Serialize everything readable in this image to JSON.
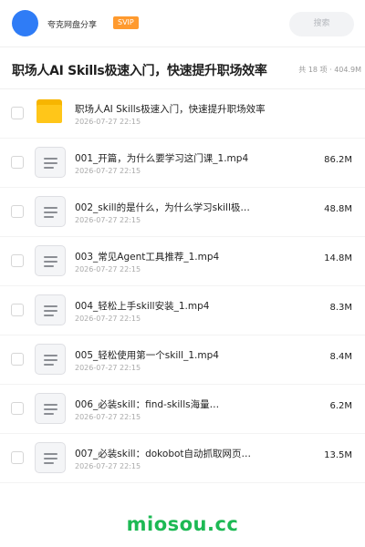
{
  "header": {
    "username": "夸克网盘分享",
    "badge": "SVIP",
    "search_placeholder": "搜索"
  },
  "folder": {
    "title": "职场人AI Skills极速入门，快速提升职场效率",
    "meta": "共 18 项 · 404.9M"
  },
  "files": [
    {
      "type": "folder",
      "name": "职场人AI Skills极速入门，快速提升职场效率",
      "date": "2026-07-27 22:15",
      "size": ""
    },
    {
      "type": "file",
      "name": "001_开篇，为什么要学习这门课_1.mp4",
      "date": "2026-07-27 22:15",
      "size": "86.2M"
    },
    {
      "type": "file",
      "name": "002_skill的是什么，为什么学习skill极…",
      "date": "2026-07-27 22:15",
      "size": "48.8M"
    },
    {
      "type": "file",
      "name": "003_常见Agent工具推荐_1.mp4",
      "date": "2026-07-27 22:15",
      "size": "14.8M"
    },
    {
      "type": "file",
      "name": "004_轻松上手skill安装_1.mp4",
      "date": "2026-07-27 22:15",
      "size": "8.3M"
    },
    {
      "type": "file",
      "name": "005_轻松使用第一个skill_1.mp4",
      "date": "2026-07-27 22:15",
      "size": "8.4M"
    },
    {
      "type": "file",
      "name": "006_必装skill：find-skills海量…",
      "date": "2026-07-27 22:15",
      "size": "6.2M"
    },
    {
      "type": "file",
      "name": "007_必装skill：dokobot自动抓取网页…",
      "date": "2026-07-27 22:15",
      "size": "13.5M"
    }
  ],
  "watermark": "miosou.cc",
  "colors": {
    "avatar": "#2f7cf6",
    "svip_badge": "#ff9a2e",
    "folder": "#ffc619",
    "watermark": "#1db954"
  }
}
